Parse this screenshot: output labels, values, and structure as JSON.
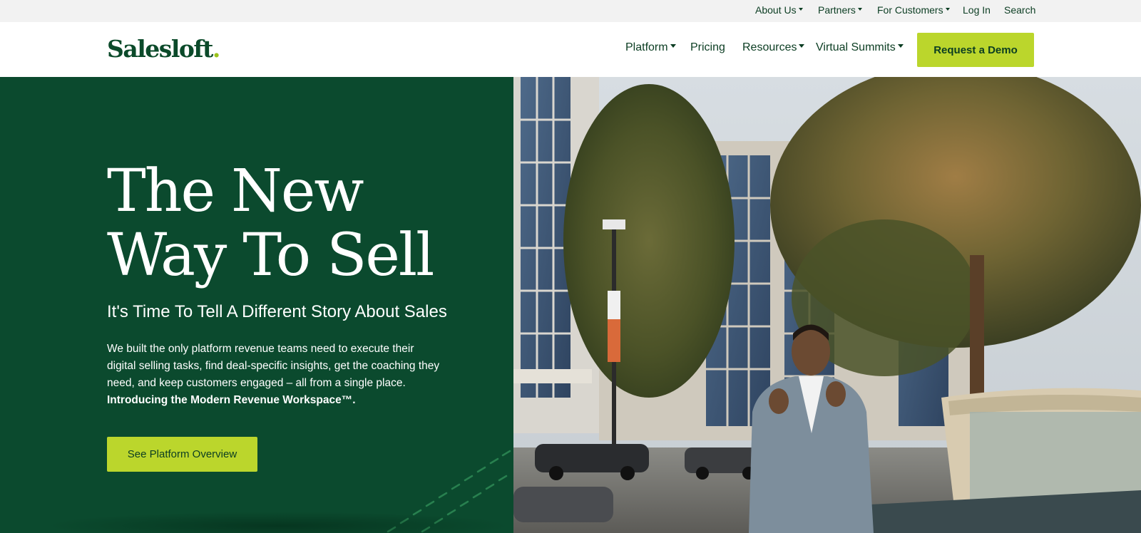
{
  "utility_nav": {
    "about_us": "About Us",
    "partners": "Partners",
    "for_customers": "For Customers",
    "log_in": "Log In",
    "search": "Search"
  },
  "header": {
    "logo_text": "Salesloft",
    "logo_dot": ".",
    "nav": {
      "platform": "Platform",
      "pricing": "Pricing",
      "resources": "Resources",
      "virtual_summits": "Virtual Summits"
    },
    "demo_button": "Request a Demo"
  },
  "hero": {
    "title_line1": "The New",
    "title_line2": "Way To Sell",
    "subtitle": "It's Time To Tell A Different Story About Sales",
    "body": "We built the only platform revenue teams need to execute their digital selling tasks, find deal-specific insights, get the coaching they need, and keep customers engaged – all from a single place.",
    "body_bold": "Introducing the Modern Revenue Workspace™.",
    "cta": "See Platform Overview"
  },
  "colors": {
    "brand_green": "#0b4a2e",
    "accent_lime": "#bbd62c",
    "text_dark_green": "#0b3d22",
    "utility_bg": "#f2f2f2"
  },
  "icons": {
    "caret": "chevron-down-icon"
  }
}
